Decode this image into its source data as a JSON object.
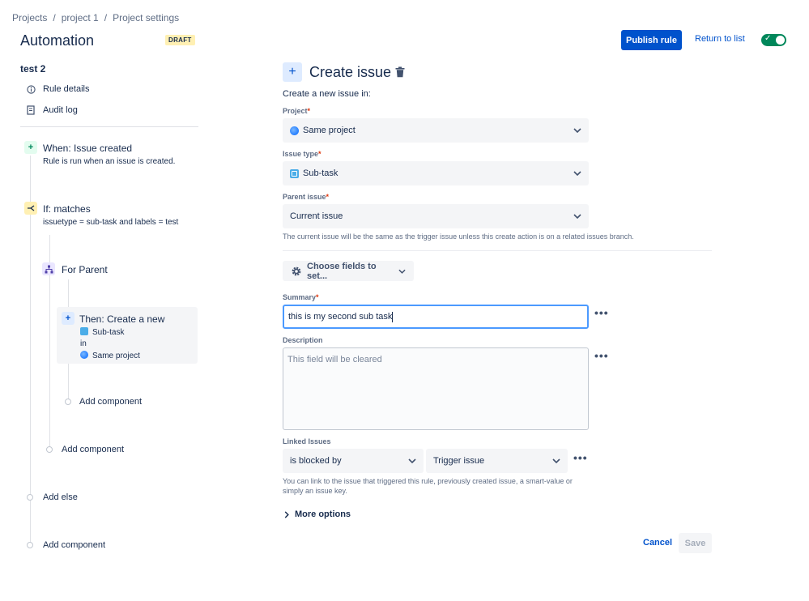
{
  "breadcrumb": [
    "Projects",
    "project 1",
    "Project settings"
  ],
  "breadcrumb_sep": "/",
  "header": {
    "title": "Automation",
    "status_badge": "DRAFT",
    "publish_label": "Publish rule",
    "return_label": "Return to list",
    "toggle_on": true
  },
  "sidebar": {
    "rule_name": "test 2",
    "links": [
      {
        "label": "Rule details",
        "icon": "info-icon"
      },
      {
        "label": "Audit log",
        "icon": "audit-log-icon"
      }
    ],
    "trigger": {
      "title": "When: Issue created",
      "subtitle": "Rule is run when an issue is created."
    },
    "condition": {
      "title": "If: matches",
      "subtitle": "issuetype = sub-task and labels = test"
    },
    "branch": {
      "title": "For Parent"
    },
    "action": {
      "title": "Then: Create a new",
      "issue_type": "Sub-task",
      "in": "in",
      "project": "Same project"
    },
    "add_component": "Add component",
    "add_else": "Add else"
  },
  "main": {
    "title": "Create issue",
    "intro": "Create a new issue in:",
    "project": {
      "label": "Project",
      "value": "Same project"
    },
    "issue_type": {
      "label": "Issue type",
      "value": "Sub-task"
    },
    "parent_issue": {
      "label": "Parent issue",
      "value": "Current issue",
      "helper": "The current issue will be the same as the trigger issue unless this create action is on a related issues branch."
    },
    "choose_fields": "Choose fields to set...",
    "summary": {
      "label": "Summary",
      "value": "this is my second sub task"
    },
    "description": {
      "label": "Description",
      "placeholder": "This field will be cleared"
    },
    "linked": {
      "label": "Linked Issues",
      "relation": "is blocked by",
      "target": "Trigger issue",
      "helper_line1": "You can link to the issue that triggered this rule, previously created issue, a smart-value or",
      "helper_line2": "simply an issue key."
    },
    "more_options": "More options",
    "required_mark": "*",
    "cancel_label": "Cancel",
    "save_label": "Save"
  },
  "colors": {
    "accent": "#0052cc",
    "toggle": "#00875a",
    "draft_bg": "#fff0b3"
  }
}
